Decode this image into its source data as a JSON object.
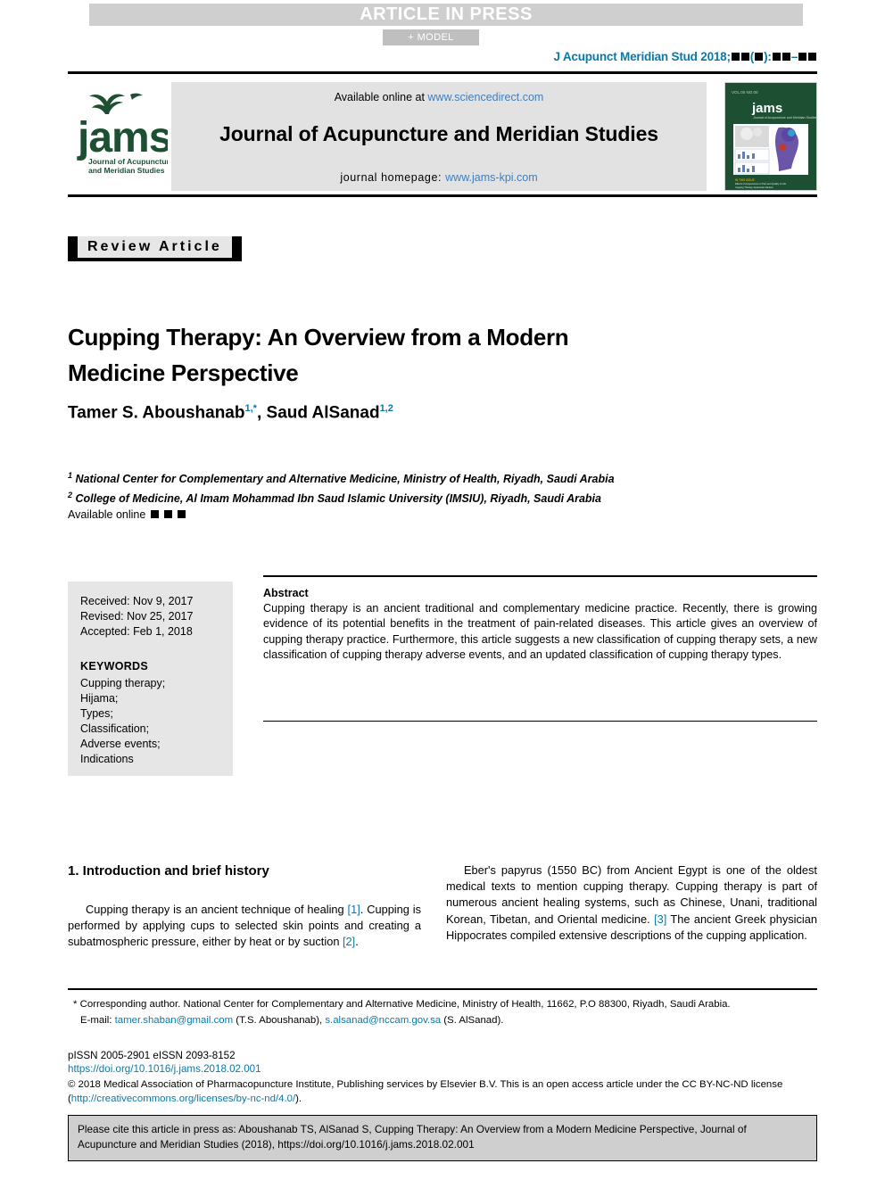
{
  "header": {
    "press_banner": "ARTICLE IN PRESS",
    "model_badge": "+ MODEL",
    "journal_ref_prefix": "J Acupunct Meridian Stud 2018;"
  },
  "masthead": {
    "available_label": "Available online at",
    "available_link": "www.sciencedirect.com",
    "journal_title": "Journal of Acupuncture and Meridian Studies",
    "homepage_label": "journal homepage:",
    "homepage_link": "www.jams-kpi.com",
    "logo_name": "jams",
    "logo_tagline_line1": "Journal of Acupuncture",
    "logo_tagline_line2": "and Meridian Studies",
    "logo_color": "#1d5033",
    "cover_alt": "jams journal cover"
  },
  "article": {
    "type_badge": "Review Article",
    "title": "Cupping Therapy: An Overview from a Modern Medicine Perspective",
    "authors": [
      {
        "name": "Tamer S. Aboushanab",
        "sup": "1,*"
      },
      {
        "name": "Saud AlSanad",
        "sup": "1,2"
      }
    ],
    "affiliations": [
      {
        "sup": "1",
        "text": "National Center for Complementary and Alternative Medicine, Ministry of Health, Riyadh, Saudi Arabia"
      },
      {
        "sup": "2",
        "text": "College of Medicine, Al Imam Mohammad Ibn Saud Islamic University (IMSIU), Riyadh, Saudi Arabia"
      }
    ],
    "available_online_label": "Available online"
  },
  "sidebar": {
    "dates": [
      "Received: Nov 9, 2017",
      "Revised: Nov 25, 2017",
      "Accepted: Feb 1, 2018"
    ],
    "keywords_heading": "KEYWORDS",
    "keywords": [
      "Cupping therapy;",
      "Hijama;",
      "Types;",
      "Classification;",
      "Adverse events;",
      "Indications"
    ]
  },
  "abstract": {
    "heading": "Abstract",
    "body": "Cupping therapy is an ancient traditional and complementary medicine practice. Recently, there is growing evidence of its potential benefits in the treatment of pain-related diseases. This article gives an overview of cupping therapy practice. Furthermore, this article suggests a new classification of cupping therapy sets, a new classification of cupping therapy adverse events, and an updated classification of cupping therapy types."
  },
  "body": {
    "section_heading": "1. Introduction and brief history",
    "left_paragraph_part1": "Cupping therapy is an ancient technique of healing ",
    "left_ref1": "[1]",
    "left_paragraph_part2": ". Cupping is performed by applying cups to selected skin points and creating a subatmospheric pressure, either by heat or by suction ",
    "left_ref2": "[2]",
    "left_paragraph_part3": ".",
    "right_paragraph_part1": "Eber's papyrus (1550 BC) from Ancient Egypt is one of the oldest medical texts to mention cupping therapy. Cupping therapy is part of numerous ancient healing systems, such as Chinese, Unani, traditional Korean, Tibetan, and Oriental medicine. ",
    "right_ref3": "[3]",
    "right_paragraph_part2": " The ancient Greek physician Hippocrates compiled extensive descriptions of the cupping application."
  },
  "footer": {
    "corresponding_marker": "*",
    "corresponding_text": "Corresponding author. National Center for Complementary and Alternative Medicine, Ministry of Health, 11662, P.O 88300, Riyadh, Saudi Arabia.",
    "email_label": "E-mail:",
    "email1": "tamer.shaban@gmail.com",
    "email1_owner": "(T.S. Aboushanab),",
    "email2": "s.alsanad@nccam.gov.sa",
    "email2_owner": "(S. AlSanad).",
    "issn": "pISSN 2005-2901   eISSN 2093-8152",
    "doi": "https://doi.org/10.1016/j.jams.2018.02.001",
    "copyright_part1": "© 2018 Medical Association of Pharmacopuncture Institute, Publishing services by Elsevier B.V. This is an open access article under the CC BY-NC-ND license (",
    "license_link": "http://creativecommons.org/licenses/by-nc-nd/4.0/",
    "copyright_part2": ").",
    "citation_notice": "Please cite this article in press as: Aboushanab TS, AlSanad S, Cupping Therapy: An Overview from a Modern Medicine Perspective, Journal of Acupuncture and Meridian Studies (2018), https://doi.org/10.1016/j.jams.2018.02.001"
  },
  "colors": {
    "link_blue": "#0b79a8",
    "sciencedirect_blue": "#3f7fbf",
    "press_gray": "#cfcfcf",
    "panel_gray": "#e6e6e6"
  }
}
